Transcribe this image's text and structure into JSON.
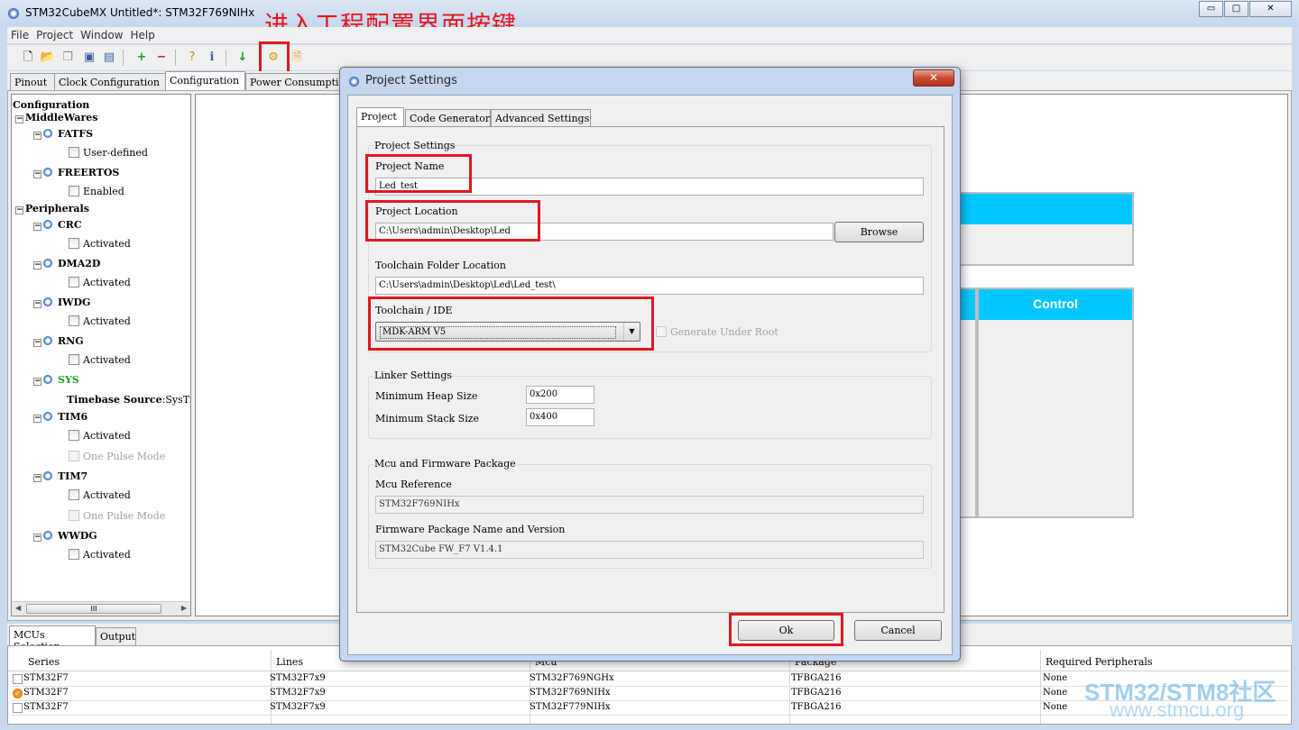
{
  "window": {
    "title": "STM32CubeMX Untitled*: STM32F769NIHx",
    "minimize": "▭",
    "maximize": "□",
    "close": "✕"
  },
  "menu": [
    "File",
    "Project",
    "Window",
    "Help"
  ],
  "annotation": "进入工程配置界面按键",
  "main_tabs": [
    "Pinout",
    "Clock Configuration",
    "Configuration",
    "Power Consumption Calculator"
  ],
  "tree": {
    "root": "Configuration",
    "middlewares": "MiddleWares",
    "fatfs": "FATFS",
    "fatfs_opt": "User-defined",
    "freertos": "FREERTOS",
    "freertos_opt": "Enabled",
    "peripherals": "Peripherals",
    "crc": "CRC",
    "activated": "Activated",
    "dma2d": "DMA2D",
    "iwdg": "IWDG",
    "rng": "RNG",
    "sys": "SYS",
    "timebase_label": "Timebase Source",
    "timebase_value": ":SysTick",
    "tim6": "TIM6",
    "one_pulse": "One Pulse Mode",
    "tim7": "TIM7",
    "wwdg": "WWDG",
    "scroll_grip": "III"
  },
  "canvas": {
    "control_title": "Control"
  },
  "dialog": {
    "title": "Project Settings",
    "close": "✕",
    "tabs": [
      "Project",
      "Code Generator",
      "Advanced Settings"
    ],
    "project_settings_label": "Project Settings",
    "project_name_label": "Project Name",
    "project_name_value": "Led_test",
    "project_location_label": "Project Location",
    "project_location_value": "C:\\Users\\admin\\Desktop\\Led",
    "browse": "Browse",
    "toolchain_folder_label": "Toolchain Folder Location",
    "toolchain_folder_value": "C:\\Users\\admin\\Desktop\\Led\\Led_test\\",
    "toolchain_ide_label": "Toolchain / IDE",
    "toolchain_ide_value": "MDK-ARM V5",
    "generate_under_root": "Generate Under Root",
    "linker_settings_label": "Linker Settings",
    "min_heap_label": "Minimum Heap Size",
    "min_heap_value": "0x200",
    "min_stack_label": "Minimum Stack Size",
    "min_stack_value": "0x400",
    "mcu_fw_label": "Mcu and Firmware Package",
    "mcu_ref_label": "Mcu Reference",
    "mcu_ref_value": "STM32F769NIHx",
    "fw_label": "Firmware Package Name and Version",
    "fw_value": "STM32Cube FW_F7 V1.4.1",
    "ok": "Ok",
    "cancel": "Cancel"
  },
  "bottom_tabs": [
    "MCUs Selection",
    "Output"
  ],
  "mcu_table": {
    "columns": [
      "Series",
      "Lines",
      "Mcu",
      "Package",
      "Required Peripherals"
    ],
    "rows": [
      [
        "STM32F7",
        "STM32F7x9",
        "STM32F769NGHx",
        "TFBGA216",
        "None"
      ],
      [
        "STM32F7",
        "STM32F7x9",
        "STM32F769NIHx",
        "TFBGA216",
        "None"
      ],
      [
        "STM32F7",
        "STM32F7x9",
        "STM32F779NIHx",
        "TFBGA216",
        "None"
      ]
    ]
  },
  "watermark": {
    "line1": "STM32/STM8社区",
    "line2": "www.stmcu.org"
  },
  "colors": {
    "annotation_red": "#e01820",
    "block_header": "#00c8ff"
  }
}
